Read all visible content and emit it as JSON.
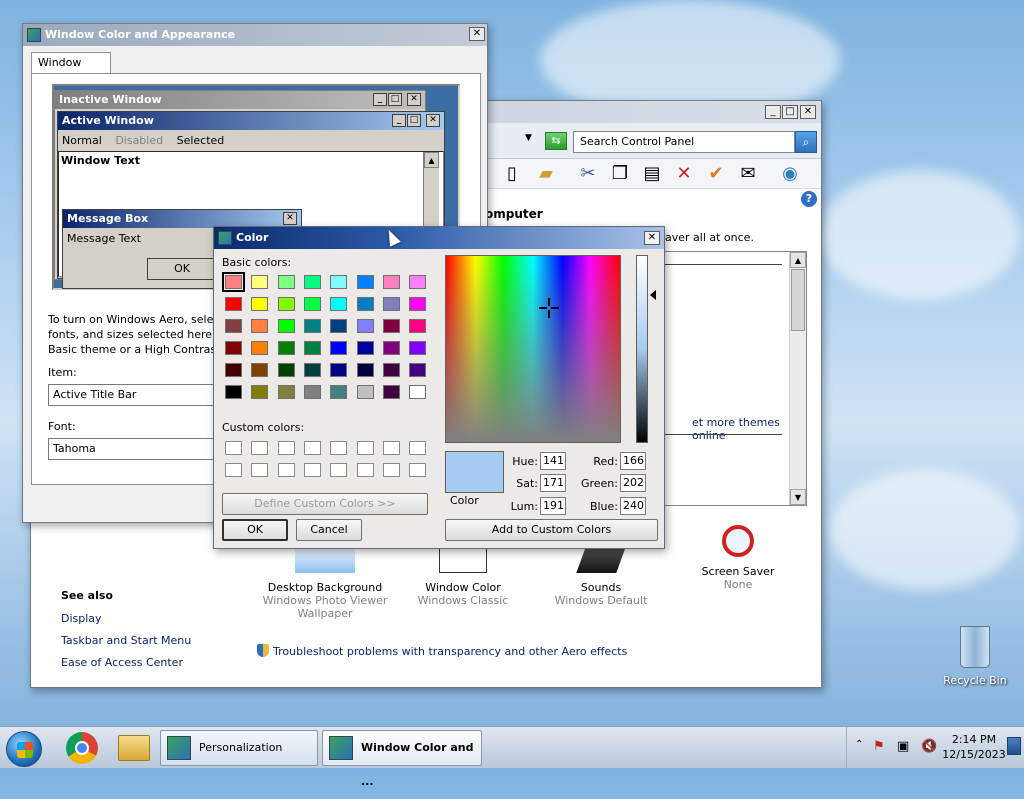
{
  "desktop": {
    "recycle_bin_label": "Recycle Bin"
  },
  "control_panel": {
    "search_placeholder": "Search Control Panel",
    "snippets": {
      "computer": "omputer",
      "saver_all": "aver all at once.",
      "more_themes": "et more themes online"
    },
    "tiles": [
      {
        "label": "Desktop Background",
        "sub": "Windows Photo Viewer Wallpaper"
      },
      {
        "label": "Window Color",
        "sub": "Windows Classic"
      },
      {
        "label": "Sounds",
        "sub": "Windows Default"
      },
      {
        "label": "Screen Saver",
        "sub": "None"
      }
    ],
    "see_also": {
      "heading": "See also",
      "links": [
        "Display",
        "Taskbar and Start Menu",
        "Ease of Access Center"
      ]
    },
    "troubleshoot": "Troubleshoot problems with transparency and other Aero effects",
    "toolbar_icons": [
      "document-icon",
      "folder-check-icon",
      "cut-icon",
      "copy-icon",
      "paste-icon",
      "delete-icon",
      "checkmark-icon",
      "mail-icon",
      "network-icon"
    ]
  },
  "wca": {
    "title": "Window Color and Appearance",
    "tab": "Window Color and Appearance",
    "preview": {
      "inactive": "Inactive Window",
      "active": "Active Window",
      "menu": [
        "Normal",
        "Disabled",
        "Selected"
      ],
      "window_text": "Window Text",
      "msgbox_title": "Message Box",
      "msgbox_text": "Message Text",
      "ok": "OK"
    },
    "desc_lines": [
      "To turn on Windows Aero, selec",
      "fonts, and sizes selected here ap",
      "Basic theme or a High Contrast"
    ],
    "item_label": "Item:",
    "item_value": "Active Title Bar",
    "font_label": "Font:",
    "font_value": "Tahoma"
  },
  "color_dialog": {
    "title": "Color",
    "basic_label": "Basic colors:",
    "custom_label": "Custom colors:",
    "basic_colors": [
      "#ff8080",
      "#ffff80",
      "#80ff80",
      "#00ff80",
      "#80ffff",
      "#0080ff",
      "#ff80c0",
      "#ff80ff",
      "#ff0000",
      "#ffff00",
      "#80ff00",
      "#00ff40",
      "#00ffff",
      "#0080c0",
      "#8080c0",
      "#ff00ff",
      "#804040",
      "#ff8040",
      "#00ff00",
      "#008080",
      "#004080",
      "#8080ff",
      "#800040",
      "#ff0080",
      "#800000",
      "#ff8000",
      "#008000",
      "#008040",
      "#0000ff",
      "#0000a0",
      "#800080",
      "#8000ff",
      "#400000",
      "#804000",
      "#004000",
      "#004040",
      "#000080",
      "#000040",
      "#400040",
      "#400080",
      "#000000",
      "#808000",
      "#808040",
      "#808080",
      "#408080",
      "#c0c0c0",
      "#400040",
      "#ffffff"
    ],
    "selected_index": 0,
    "define_custom": "Define Custom Colors >>",
    "ok": "OK",
    "cancel": "Cancel",
    "color_label": "Color",
    "hue_label": "Hue:",
    "hue": "141",
    "sat_label": "Sat:",
    "sat": "171",
    "lum_label": "Lum:",
    "lum": "191",
    "red_label": "Red:",
    "red": "166",
    "green_label": "Green:",
    "green": "202",
    "blue_label": "Blue:",
    "blue": "240",
    "add_custom": "Add to Custom Colors"
  },
  "taskbar": {
    "items": [
      "Personalization",
      "Window Color and ..."
    ],
    "time": "2:14 PM",
    "date": "12/15/2023"
  }
}
